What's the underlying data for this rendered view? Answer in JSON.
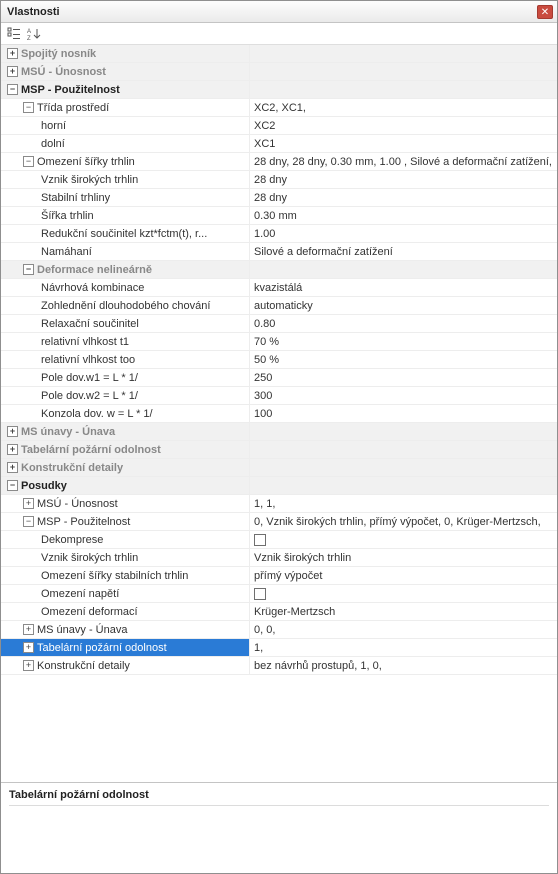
{
  "window": {
    "title": "Vlastnosti"
  },
  "toolbar": {
    "categorized_tip": "Categorized",
    "sort_tip": "Sort"
  },
  "tree": {
    "spojity_nosnik": "Spojitý nosník",
    "msu_unosnost": "MSÚ - Únosnost",
    "msp_pouz": "MSP - Použitelnost",
    "trida_prostredi": {
      "label": "Třída prostředí",
      "value": "XC2, XC1,"
    },
    "horni": {
      "label": "horní",
      "value": "XC2"
    },
    "dolni": {
      "label": "dolní",
      "value": "XC1"
    },
    "omezeni_sirky": {
      "label": "Omezení šířky trhlin",
      "value": "28 dny, 28 dny, 0.30 mm, 1.00 , Silové a deformační zatížení,"
    },
    "vznik_sir": {
      "label": "Vznik širokých trhlin",
      "value": "28 dny"
    },
    "stabilni_trhliny": {
      "label": "Stabilní trhliny",
      "value": "28 dny"
    },
    "sirka_trhlin": {
      "label": "Šířka trhlin",
      "value": "0.30 mm"
    },
    "redukcni": {
      "label": "Redukční součinitel kzt*fctm(t), r...",
      "value": "1.00"
    },
    "namahani": {
      "label": "Namáhaní",
      "value": "Silové a deformační zatížení"
    },
    "deformace_nl": "Deformace nelineárně",
    "navrhova_komb": {
      "label": "Návrhová kombinace",
      "value": "kvazistálá"
    },
    "zohledneni": {
      "label": "Zohlednění dlouhodobého chování",
      "value": "automaticky"
    },
    "relax_souc": {
      "label": "Relaxační součinitel",
      "value": "0.80"
    },
    "rel_vlh_t1": {
      "label": "relativní vlhkost t1",
      "value": "70 %"
    },
    "rel_vlh_too": {
      "label": "relativní vlhkost too",
      "value": "50 %"
    },
    "pole_w1": {
      "label": "Pole dov.w1 = L * 1/",
      "value": "250"
    },
    "pole_w2": {
      "label": "Pole dov.w2 = L * 1/",
      "value": "300"
    },
    "konzola_w": {
      "label": "Konzola dov. w = L * 1/",
      "value": "100"
    },
    "ms_unavy": "MS únavy - Únava",
    "tab_pozarni": "Tabelární požární odolnost",
    "konstr_det": "Konstrukční detaily",
    "posudky": "Posudky",
    "p_msu": {
      "label": "MSÚ - Únosnost",
      "value": "1, 1,"
    },
    "p_msp": {
      "label": "MSP - Použitelnost",
      "value": "0, Vznik širokých trhlin, přímý výpočet, 0, Krüger-Mertzsch,"
    },
    "p_dekomprese": {
      "label": "Dekomprese",
      "value": ""
    },
    "p_vznik": {
      "label": "Vznik širokých trhlin",
      "value": "Vznik širokých trhlin"
    },
    "p_omez_sir": {
      "label": "Omezení šířky stabilních trhlin",
      "value": "přímý výpočet"
    },
    "p_omez_nap": {
      "label": "Omezení napětí",
      "value": ""
    },
    "p_omez_def": {
      "label": "Omezení deformací",
      "value": "Krüger-Mertzsch"
    },
    "p_ms_unavy": {
      "label": "MS únavy - Únava",
      "value": "0, 0,"
    },
    "p_tab_poz": {
      "label": "Tabelární požární odolnost",
      "value": "1,"
    },
    "p_konstr_det": {
      "label": "Konstrukční detaily",
      "value": "bez návrhů prostupů, 1, 0,"
    }
  },
  "footer": {
    "caption": "Tabelární požární odolnost"
  }
}
